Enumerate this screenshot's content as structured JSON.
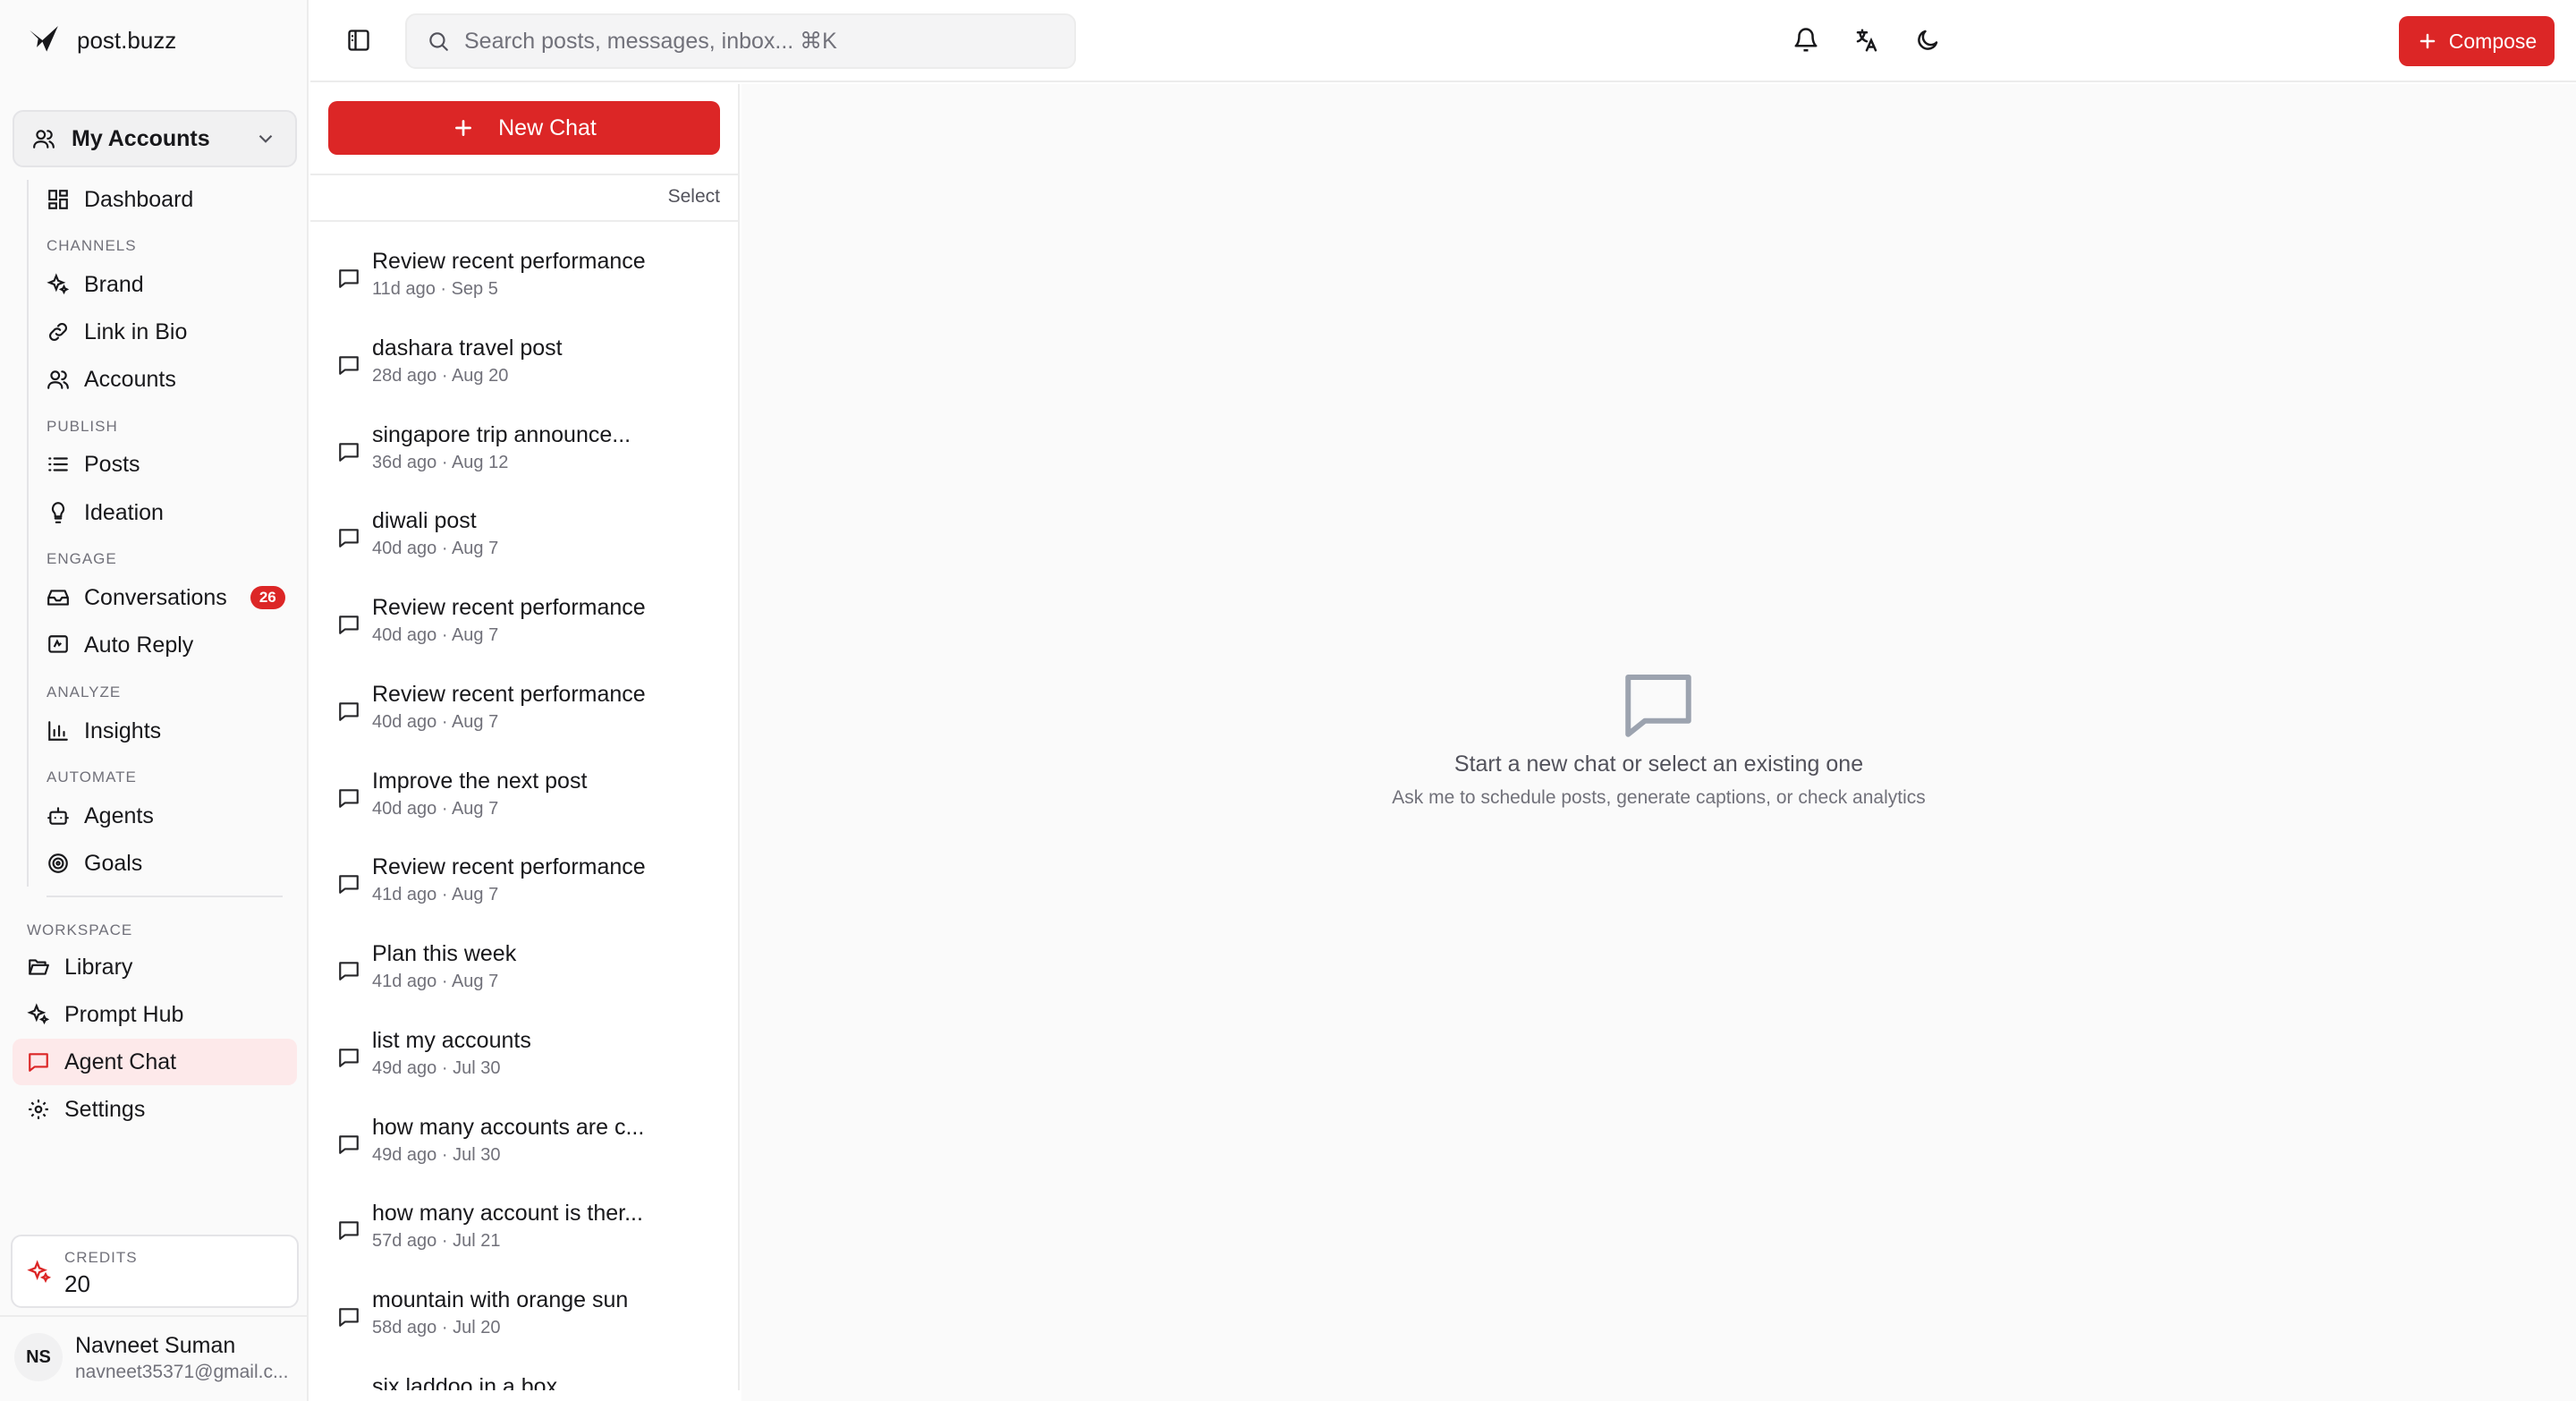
{
  "brand": {
    "name": "post.buzz"
  },
  "account_selector": {
    "label": "My Accounts"
  },
  "nav": {
    "dashboard": "Dashboard",
    "sections": {
      "channels": "CHANNELS",
      "publish": "PUBLISH",
      "engage": "ENGAGE",
      "analyze": "ANALYZE",
      "automate": "AUTOMATE"
    },
    "brand_item": "Brand",
    "link_in_bio": "Link in Bio",
    "accounts": "Accounts",
    "posts": "Posts",
    "ideation": "Ideation",
    "conversations": "Conversations",
    "conversations_badge": "26",
    "auto_reply": "Auto Reply",
    "insights": "Insights",
    "agents": "Agents",
    "goals": "Goals"
  },
  "workspace": {
    "label": "WORKSPACE",
    "library": "Library",
    "prompt_hub": "Prompt Hub",
    "agent_chat": "Agent Chat",
    "settings": "Settings"
  },
  "credits": {
    "label": "CREDITS",
    "value": "20"
  },
  "user": {
    "initials": "NS",
    "name": "Navneet Suman",
    "email": "navneet35371@gmail.c..."
  },
  "header": {
    "search_placeholder": "Search posts, messages, inbox... ⌘K",
    "compose_label": "Compose"
  },
  "chat_list": {
    "new_chat_label": "New Chat",
    "select_label": "Select",
    "items": [
      {
        "title": "Review recent performance",
        "meta": "11d ago · Sep 5"
      },
      {
        "title": "dashara travel post",
        "meta": "28d ago · Aug 20"
      },
      {
        "title": "singapore trip announce...",
        "meta": "36d ago · Aug 12"
      },
      {
        "title": "diwali post",
        "meta": "40d ago · Aug 7"
      },
      {
        "title": "Review recent performance",
        "meta": "40d ago · Aug 7"
      },
      {
        "title": "Review recent performance",
        "meta": "40d ago · Aug 7"
      },
      {
        "title": "Improve the next post",
        "meta": "40d ago · Aug 7"
      },
      {
        "title": "Review recent performance",
        "meta": "41d ago · Aug 7"
      },
      {
        "title": "Plan this week",
        "meta": "41d ago · Aug 7"
      },
      {
        "title": "list my accounts",
        "meta": "49d ago · Jul 30"
      },
      {
        "title": "how many accounts are c...",
        "meta": "49d ago · Jul 30"
      },
      {
        "title": "how many account is ther...",
        "meta": "57d ago · Jul 21"
      },
      {
        "title": "mountain with orange sun",
        "meta": "58d ago · Jul 20"
      },
      {
        "title": "six laddoo in a box",
        "meta": ""
      }
    ]
  },
  "empty_state": {
    "title": "Start a new chat or select an existing one",
    "subtitle": "Ask me to schedule posts, generate captions, or check analytics"
  },
  "colors": {
    "accent": "#dc2626",
    "active_bg": "#fde9ea"
  }
}
